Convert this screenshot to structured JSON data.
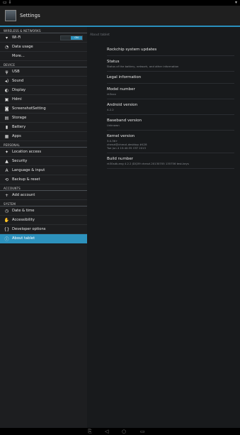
{
  "statusbar": {
    "left_icons": "▭ ⇩",
    "right_icon": "▾"
  },
  "actionbar": {
    "title": "Settings"
  },
  "sidebar": {
    "sections": [
      {
        "header": "WIRELESS & NETWORKS",
        "items": [
          {
            "label": "Wi-Fi",
            "icon": "wifi-icon",
            "glyph": "▾",
            "toggle": "ON"
          },
          {
            "label": "Data usage",
            "icon": "data-usage-icon",
            "glyph": "◔"
          },
          {
            "label": "More...",
            "icon": "",
            "glyph": ""
          }
        ]
      },
      {
        "header": "DEVICE",
        "items": [
          {
            "label": "USB",
            "icon": "usb-icon",
            "glyph": "ψ"
          },
          {
            "label": "Sound",
            "icon": "sound-icon",
            "glyph": "◂)"
          },
          {
            "label": "Display",
            "icon": "display-icon",
            "glyph": "◐"
          },
          {
            "label": "Hdmi",
            "icon": "hdmi-icon",
            "glyph": "▣"
          },
          {
            "label": "ScreenshotSetting",
            "icon": "screenshot-icon",
            "glyph": "◙"
          },
          {
            "label": "Storage",
            "icon": "storage-icon",
            "glyph": "▤"
          },
          {
            "label": "Battery",
            "icon": "battery-icon",
            "glyph": "▮"
          },
          {
            "label": "Apps",
            "icon": "apps-icon",
            "glyph": "▦"
          }
        ]
      },
      {
        "header": "PERSONAL",
        "items": [
          {
            "label": "Location access",
            "icon": "location-icon",
            "glyph": "✦"
          },
          {
            "label": "Security",
            "icon": "lock-icon",
            "glyph": "▲"
          },
          {
            "label": "Language & input",
            "icon": "language-icon",
            "glyph": "A"
          },
          {
            "label": "Backup & reset",
            "icon": "backup-icon",
            "glyph": "⟲"
          }
        ]
      },
      {
        "header": "ACCOUNTS",
        "items": [
          {
            "label": "Add account",
            "icon": "add-icon",
            "glyph": "+"
          }
        ]
      },
      {
        "header": "SYSTEM",
        "items": [
          {
            "label": "Date & time",
            "icon": "clock-icon",
            "glyph": "◷"
          },
          {
            "label": "Accessibility",
            "icon": "accessibility-icon",
            "glyph": "✋"
          },
          {
            "label": "Developer options",
            "icon": "developer-icon",
            "glyph": "{}"
          },
          {
            "label": "About tablet",
            "icon": "info-icon",
            "glyph": "ⓘ",
            "selected": true
          }
        ]
      }
    ]
  },
  "about": {
    "header": "About tablet",
    "prefs": [
      {
        "title": "Rockchip system updates",
        "summary": ""
      },
      {
        "title": "Status",
        "summary": "Status of the battery, network, and other information"
      },
      {
        "title": "Legal information",
        "summary": ""
      },
      {
        "title": "Model number",
        "summary": "rk3xxx"
      },
      {
        "title": "Android version",
        "summary": "4.2.2"
      },
      {
        "title": "Baseband version",
        "summary": "Unknown"
      },
      {
        "title": "Kernel version",
        "summary": "3.0.36+\nchenzl@chenzl-desktop #428\nTue Jun 4 15:40:35 CST 2013"
      },
      {
        "title": "Build number",
        "summary": "rk30sdk-eng 4.2.2 JDQ39 chenzl.20130705 135756 test-keys"
      }
    ]
  },
  "navbar": {
    "back": "◁",
    "home": "○",
    "recents": "▭",
    "screenshot": "⎘"
  },
  "colors": {
    "accent": "#2d92bd",
    "background": "#181a1c",
    "sidebar": "#1d1e20"
  }
}
